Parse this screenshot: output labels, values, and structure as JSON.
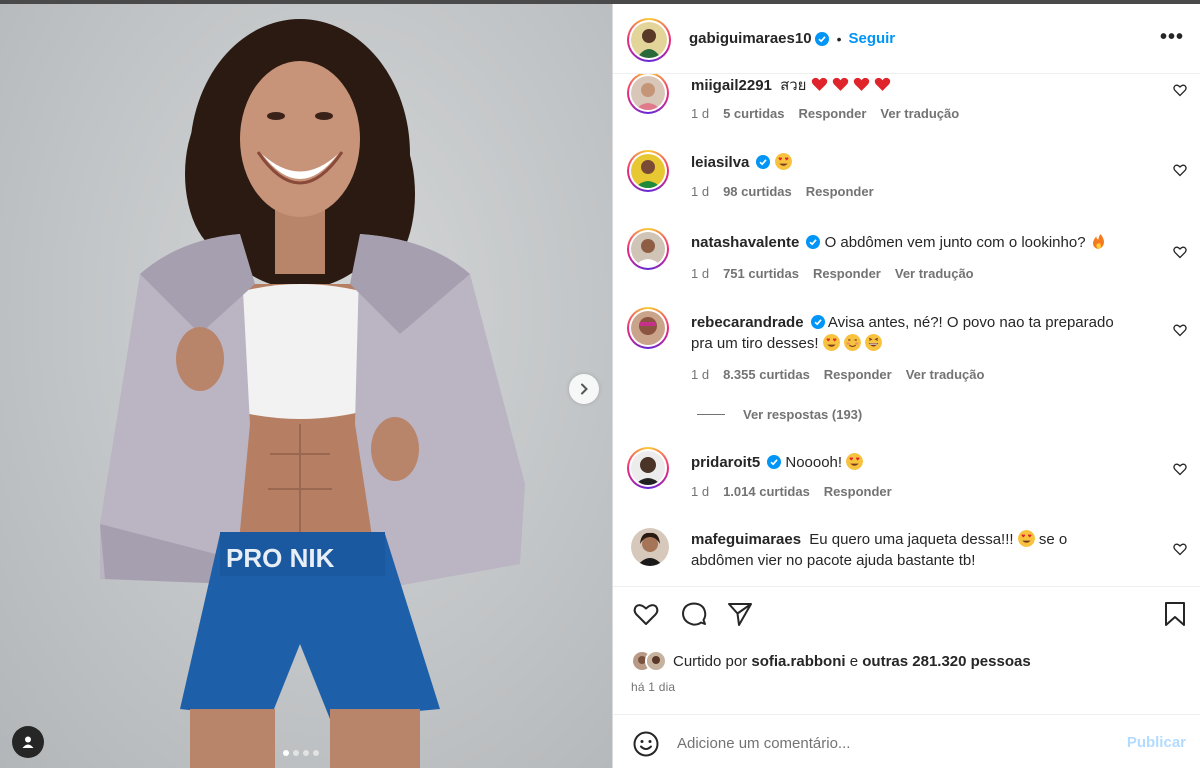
{
  "post": {
    "author": "gabiguimaraes10",
    "follow_label": "Seguir",
    "separator": "•",
    "more_label": "•••",
    "verified": true
  },
  "media": {
    "image_count": 4,
    "active_index": 0,
    "shorts_text": "PRO NIK"
  },
  "comments": [
    {
      "user": "miigail2291",
      "verified": false,
      "text": "สวย",
      "emojis": [
        "red-heart",
        "red-heart",
        "red-heart",
        "red-heart"
      ],
      "time": "1 d",
      "likes": "5 curtidas",
      "reply": "Responder",
      "translate": "Ver tradução"
    },
    {
      "user": "leiasilva",
      "verified": true,
      "text": "",
      "emojis": [
        "heart-eyes"
      ],
      "time": "1 d",
      "likes": "98 curtidas",
      "reply": "Responder",
      "translate": ""
    },
    {
      "user": "natashavalente",
      "verified": true,
      "text": "O abdômen vem junto com o lookinho?",
      "emojis": [
        "fire"
      ],
      "time": "1 d",
      "likes": "751 curtidas",
      "reply": "Responder",
      "translate": "Ver tradução"
    },
    {
      "user": "rebecarandrade",
      "verified": true,
      "text_line1": "Avisa antes, né?! O povo nao ta preparado",
      "text_line2": "pra um tiro desses!",
      "emojis": [
        "heart-eyes",
        "smiling-face",
        "laughing"
      ],
      "time": "1 d",
      "likes": "8.355 curtidas",
      "reply": "Responder",
      "translate": "Ver tradução",
      "replies_label": "Ver respostas (193)"
    },
    {
      "user": "pridaroit5",
      "verified": true,
      "text": "Nooooh!",
      "emojis": [
        "heart-eyes"
      ],
      "time": "1 d",
      "likes": "1.014 curtidas",
      "reply": "Responder",
      "translate": ""
    },
    {
      "user": "mafeguimaraes",
      "verified": false,
      "text_line1": "Eu quero uma jaqueta dessa!!!",
      "text_line1b": "se o",
      "text_line2": "abdômen vier no pacote ajuda bastante tb!",
      "emojis": [
        "heart-eyes"
      ]
    }
  ],
  "footer": {
    "liked_by_prefix": "Curtido por",
    "liked_by_user": "sofia.rabboni",
    "liked_by_join": "e",
    "liked_by_others": "outras 281.320 pessoas",
    "time_ago": "há 1 dia",
    "comment_placeholder": "Adicione um comentário...",
    "publish_label": "Publicar"
  },
  "icons": {
    "like": "heart-icon",
    "comment": "comment-icon",
    "share": "send-icon",
    "save": "bookmark-icon",
    "emoji": "smiley-icon",
    "tag": "user-tag-icon",
    "next": "chevron-right-icon"
  },
  "colors": {
    "accent": "#0095f6",
    "publish_disabled": "#b3dbff",
    "muted_text": "#737373",
    "verified": "#0095f6"
  }
}
